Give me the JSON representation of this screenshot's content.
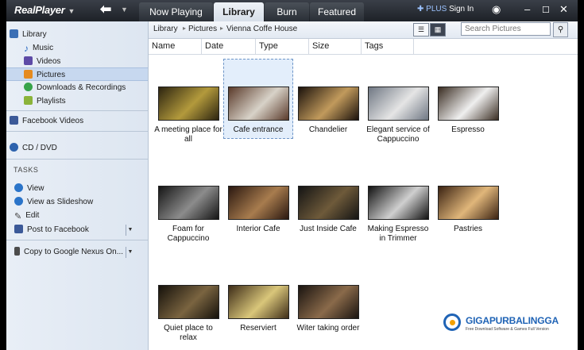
{
  "app": {
    "name": "RealPlayer"
  },
  "tabs": [
    {
      "label": "Now Playing"
    },
    {
      "label": "Library"
    },
    {
      "label": "Burn"
    },
    {
      "label": "Featured"
    }
  ],
  "account": {
    "plus": "PLUS",
    "sign_in": "Sign In"
  },
  "sidebar": {
    "library": "Library",
    "music": "Music",
    "videos": "Videos",
    "pictures": "Pictures",
    "downloads": "Downloads & Recordings",
    "playlists": "Playlists",
    "facebook_videos": "Facebook Videos",
    "cd_dvd": "CD / DVD",
    "tasks_heading": "TASKS",
    "view": "View",
    "view_slideshow": "View as Slideshow",
    "edit": "Edit",
    "post_facebook": "Post to Facebook",
    "copy_device": "Copy to Google Nexus On..."
  },
  "breadcrumb": [
    "Library",
    "Pictures",
    "Vienna Coffe House"
  ],
  "search": {
    "placeholder": "Search Pictures"
  },
  "columns": [
    "Name",
    "Date",
    "Type",
    "Size",
    "Tags"
  ],
  "pictures": [
    {
      "caption": "A meeting place for all",
      "colors": [
        "#2c2410",
        "#b39a3c"
      ]
    },
    {
      "caption": "Cafe entrance",
      "colors": [
        "#5a3a2a",
        "#d8d2c8"
      ]
    },
    {
      "caption": "Chandelier",
      "colors": [
        "#1b120c",
        "#c19a5c"
      ]
    },
    {
      "caption": "Elegant service of Cappuccino",
      "colors": [
        "#6f7783",
        "#e5e5e5"
      ]
    },
    {
      "caption": "Espresso",
      "colors": [
        "#3a2d22",
        "#efefef"
      ]
    },
    {
      "caption": "Foam for Cappuccino",
      "colors": [
        "#151515",
        "#8c8c8c"
      ]
    },
    {
      "caption": "Interior Cafe",
      "colors": [
        "#2a1810",
        "#a87c4e"
      ]
    },
    {
      "caption": "Just Inside Cafe",
      "colors": [
        "#141414",
        "#6e5a3a"
      ]
    },
    {
      "caption": "Making Espresso in Trimmer",
      "colors": [
        "#111111",
        "#cfcfcf"
      ]
    },
    {
      "caption": "Pastries",
      "colors": [
        "#3a2212",
        "#e0b67a"
      ]
    },
    {
      "caption": "Quiet place to relax",
      "colors": [
        "#15110b",
        "#7a6440"
      ]
    },
    {
      "caption": "Reserviert",
      "colors": [
        "#3d2c18",
        "#d9c67a"
      ]
    },
    {
      "caption": "Witer taking order",
      "colors": [
        "#1a1410",
        "#8a6a4a"
      ]
    }
  ],
  "watermark": {
    "title": "GIGAPURBALINGGA",
    "subtitle": "Free Download Software & Games Full Version"
  }
}
